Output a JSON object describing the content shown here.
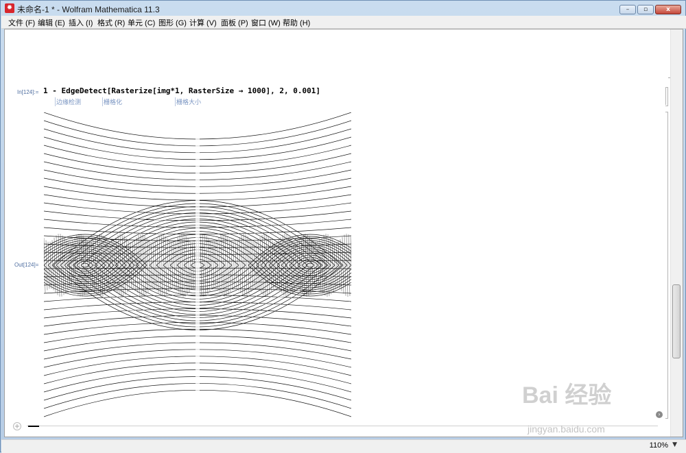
{
  "window": {
    "title": "未命名-1 * - Wolfram Mathematica 11.3",
    "app_icon": "mathematica-icon",
    "buttons": {
      "minimize": "–",
      "maximize": "▫",
      "close": "x"
    }
  },
  "menubar": {
    "items": [
      "文件 (F)",
      "编辑 (E)",
      "插入 (I)",
      "格式 (R)",
      "单元 (C)",
      "图形 (G)",
      "计算 (V)",
      "面板 (P)",
      "窗口 (W)",
      "帮助 (H)"
    ]
  },
  "notebook": {
    "input_label": "In[124]:=",
    "output_label": "Out[124]=",
    "code": "1 - EdgeDetect[Rasterize[img*1, RasterSize → 1000], 2, 0.001]",
    "hints": [
      "边缘检测",
      "栅格化",
      "栅格大小"
    ]
  },
  "statusbar": {
    "zoom": "110%",
    "zoom_arrow": "▼"
  },
  "watermark": {
    "brand": "Bai 经验",
    "url": "jingyan.baidu.com"
  }
}
